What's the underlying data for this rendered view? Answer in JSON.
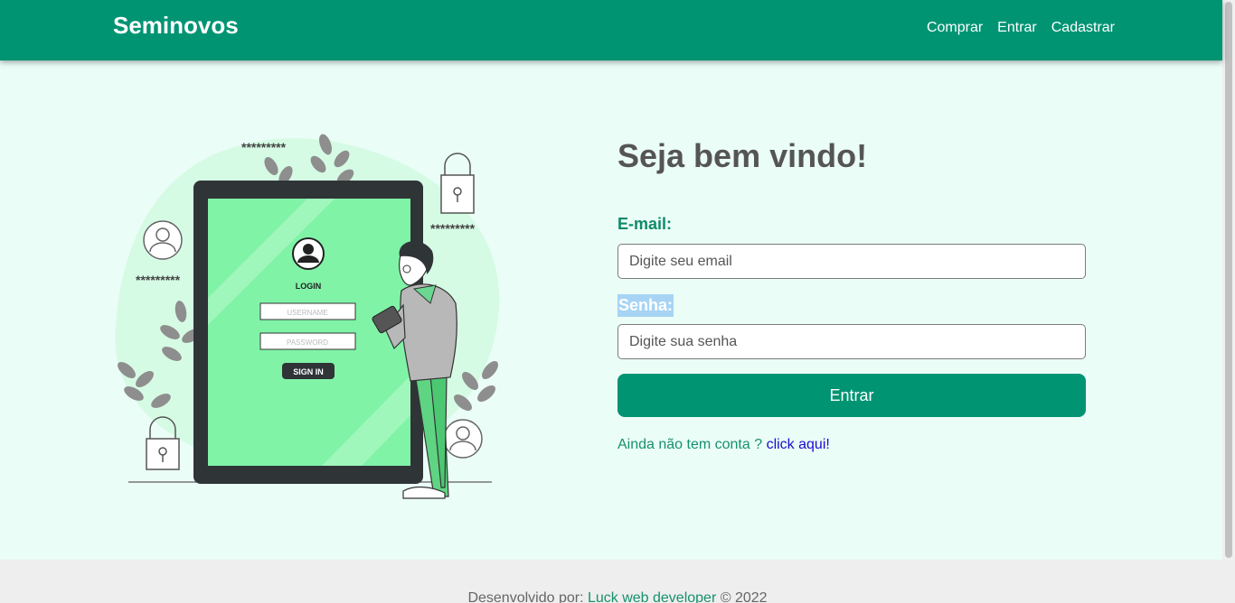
{
  "navbar": {
    "brand": "Seminovos",
    "links": [
      "Comprar",
      "Entrar",
      "Cadastrar"
    ]
  },
  "illustration": {
    "password_masks": [
      "*********",
      "*********",
      "*********"
    ],
    "login_title": "LOGIN",
    "username_placeholder": "USERNAME",
    "password_placeholder": "PASSWORD",
    "sign_in_label": "SIGN IN"
  },
  "form": {
    "welcome": "Seja bem vindo!",
    "email_label": "E-mail:",
    "email_placeholder": "Digite seu email",
    "password_label": "Senha:",
    "password_placeholder": "Digite sua senha",
    "submit_label": "Entrar",
    "signup_prompt": "Ainda não tem conta ?",
    "signup_link": "click aqui!"
  },
  "footer": {
    "prefix": "Desenvolvido por:",
    "author": "Luck web developer",
    "suffix": "© 2022"
  },
  "colors": {
    "primary": "#009473",
    "background": "#ebfdf7",
    "link": "#1a0dcf",
    "heading": "#555555"
  }
}
